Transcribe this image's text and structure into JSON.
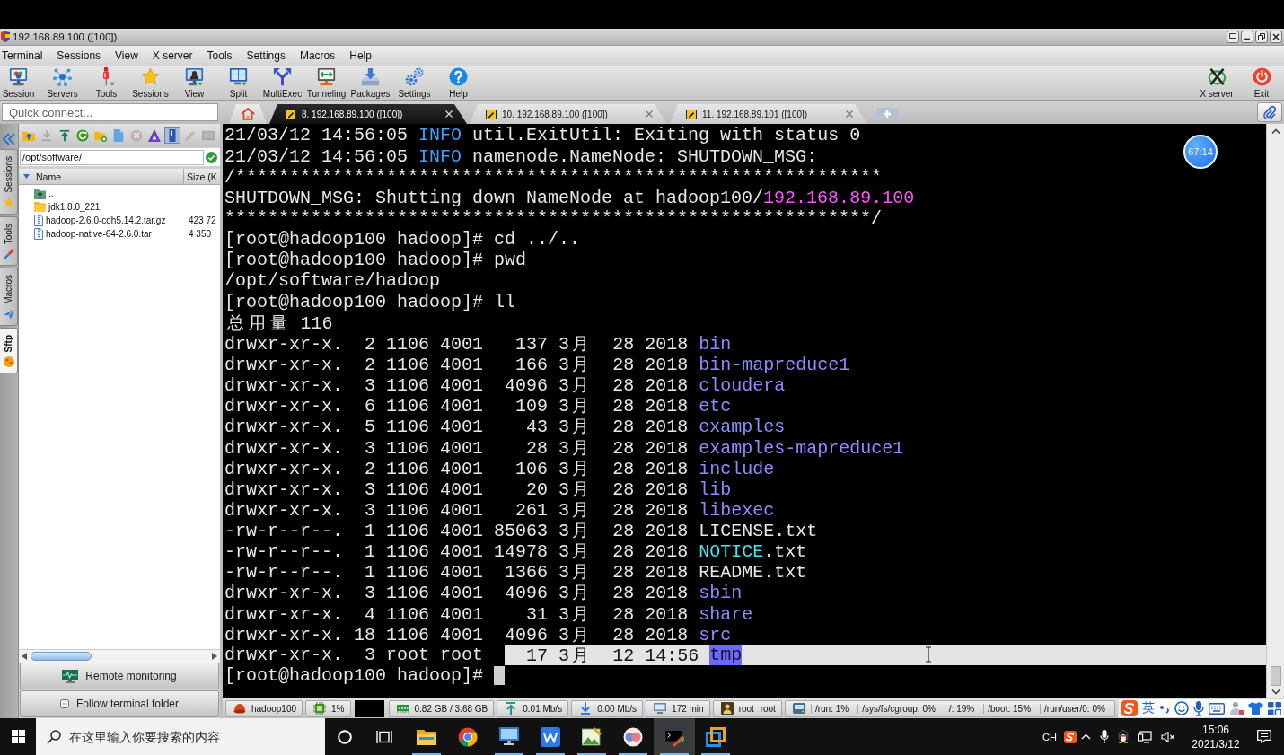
{
  "window": {
    "title": "192.168.89.100 ([100])"
  },
  "menu": [
    "Terminal",
    "Sessions",
    "View",
    "X server",
    "Tools",
    "Settings",
    "Macros",
    "Help"
  ],
  "toolbar": {
    "left": [
      "Session",
      "Servers",
      "Tools",
      "Sessions",
      "View",
      "Split",
      "MultiExec",
      "Tunneling",
      "Packages",
      "Settings",
      "Help"
    ],
    "right": [
      "X server",
      "Exit"
    ]
  },
  "quick_connect": {
    "placeholder": "Quick connect..."
  },
  "tabs": [
    {
      "label": "8. 192.168.89.100 ([100])",
      "selected": true
    },
    {
      "label": "10. 192.168.89.100 ([100])",
      "selected": false
    },
    {
      "label": "11. 192.168.89.101 ([100])",
      "selected": false
    }
  ],
  "side_tabs": [
    {
      "label": "Sessions",
      "selected": false
    },
    {
      "label": "Tools",
      "selected": false
    },
    {
      "label": "Macros",
      "selected": false
    },
    {
      "label": "Sftp",
      "selected": true
    }
  ],
  "sftp": {
    "toolbar": [
      {
        "disabled": false,
        "on": false
      },
      {
        "disabled": true,
        "on": false
      },
      {
        "disabled": false,
        "on": false
      },
      {
        "disabled": false,
        "on": false
      },
      {
        "disabled": false,
        "on": false
      },
      {
        "disabled": false,
        "on": false
      },
      {
        "disabled": true,
        "on": false
      },
      {
        "disabled": false,
        "on": false
      },
      {
        "disabled": false,
        "on": true
      },
      {
        "disabled": true,
        "on": false
      },
      {
        "disabled": true,
        "on": false
      }
    ],
    "path": "/opt/software/",
    "columns": [
      "Name",
      "Size (K"
    ],
    "rows": [
      {
        "kind": "parent",
        "name": ".."
      },
      {
        "kind": "folder",
        "name": "jdk1.8.0_221"
      },
      {
        "kind": "file",
        "name": "hadoop-2.6.0-cdh5.14.2.tar.gz",
        "size": "423 72"
      },
      {
        "kind": "file",
        "name": "hadoop-native-64-2.6.0.tar",
        "size": "4 350"
      }
    ],
    "remote_monitoring": "Remote monitoring",
    "follow_folder": {
      "label": "Follow terminal folder",
      "checked": false
    }
  },
  "terminal": {
    "lines": [
      {
        "segments": [
          {
            "text": "21/03/12 14:56:05 "
          },
          {
            "text": "INFO",
            "color": "#3aa2ff"
          },
          {
            "text": " util.ExitUtil: Exiting with status 0"
          }
        ]
      },
      {
        "segments": [
          {
            "text": "21/03/12 14:56:05 "
          },
          {
            "text": "INFO",
            "color": "#3aa2ff"
          },
          {
            "text": " namenode.NameNode: SHUTDOWN_MSG:"
          }
        ]
      },
      {
        "segments": [
          {
            "text": "/************************************************************"
          }
        ]
      },
      {
        "segments": [
          {
            "text": "SHUTDOWN_MSG: Shutting down NameNode at hadoop100/"
          },
          {
            "text": "192.168.89.100",
            "color": "#ff55ff"
          }
        ]
      },
      {
        "segments": [
          {
            "text": "************************************************************/"
          }
        ]
      },
      {
        "segments": [
          {
            "text": "[root@hadoop100 hadoop]# cd ../.."
          }
        ]
      },
      {
        "segments": [
          {
            "text": "[root@hadoop100 hadoop]# pwd"
          }
        ]
      },
      {
        "segments": [
          {
            "text": "/opt/software/hadoop"
          }
        ]
      },
      {
        "segments": [
          {
            "text": "[root@hadoop100 hadoop]# ll"
          }
        ]
      },
      {
        "segments": [
          {
            "text": "总用量 116"
          }
        ]
      },
      {
        "segments": [
          {
            "text": "drwxr-xr-x.  2 1106 4001   137 3月  28 2018 "
          },
          {
            "text": "bin",
            "color": "#8c8cff"
          }
        ]
      },
      {
        "segments": [
          {
            "text": "drwxr-xr-x.  2 1106 4001   166 3月  28 2018 "
          },
          {
            "text": "bin-mapreduce1",
            "color": "#8c8cff"
          }
        ]
      },
      {
        "segments": [
          {
            "text": "drwxr-xr-x.  3 1106 4001  4096 3月  28 2018 "
          },
          {
            "text": "cloudera",
            "color": "#8c8cff"
          }
        ]
      },
      {
        "segments": [
          {
            "text": "drwxr-xr-x.  6 1106 4001   109 3月  28 2018 "
          },
          {
            "text": "etc",
            "color": "#8c8cff"
          }
        ]
      },
      {
        "segments": [
          {
            "text": "drwxr-xr-x.  5 1106 4001    43 3月  28 2018 "
          },
          {
            "text": "examples",
            "color": "#8c8cff"
          }
        ]
      },
      {
        "segments": [
          {
            "text": "drwxr-xr-x.  3 1106 4001    28 3月  28 2018 "
          },
          {
            "text": "examples-mapreduce1",
            "color": "#8c8cff"
          }
        ]
      },
      {
        "segments": [
          {
            "text": "drwxr-xr-x.  2 1106 4001   106 3月  28 2018 "
          },
          {
            "text": "include",
            "color": "#8c8cff"
          }
        ]
      },
      {
        "segments": [
          {
            "text": "drwxr-xr-x.  3 1106 4001    20 3月  28 2018 "
          },
          {
            "text": "lib",
            "color": "#8c8cff"
          }
        ]
      },
      {
        "segments": [
          {
            "text": "drwxr-xr-x.  3 1106 4001   261 3月  28 2018 "
          },
          {
            "text": "libexec",
            "color": "#8c8cff"
          }
        ]
      },
      {
        "segments": [
          {
            "text": "-rw-r--r--.  1 1106 4001 85063 3月  28 2018 LICENSE.txt"
          }
        ]
      },
      {
        "segments": [
          {
            "text": "-rw-r--r--.  1 1106 4001 14978 3月  28 2018 "
          },
          {
            "text": "NOTICE",
            "color": "#3ee6f2"
          },
          {
            "text": ".txt"
          }
        ]
      },
      {
        "segments": [
          {
            "text": "-rw-r--r--.  1 1106 4001  1366 3月  28 2018 README.txt"
          }
        ]
      },
      {
        "segments": [
          {
            "text": "drwxr-xr-x.  3 1106 4001  4096 3月  28 2018 "
          },
          {
            "text": "sbin",
            "color": "#8c8cff"
          }
        ]
      },
      {
        "segments": [
          {
            "text": "drwxr-xr-x.  4 1106 4001    31 3月  28 2018 "
          },
          {
            "text": "share",
            "color": "#8c8cff"
          }
        ]
      },
      {
        "segments": [
          {
            "text": "drwxr-xr-x. 18 1106 4001  4096 3月  28 2018 "
          },
          {
            "text": "src",
            "color": "#8c8cff"
          }
        ]
      },
      {
        "segments": [
          {
            "text": "drwxr-xr-x.  3 root root  ",
            "selected": false
          },
          {
            "text": "  17 3月  12 14:56 ",
            "selected": true
          },
          {
            "text": "tmp",
            "color": "#6a6aff",
            "selected": true
          }
        ]
      }
    ],
    "prompt": {
      "text": "[root@hadoop100 hadoop]#",
      "cursor": true
    },
    "timer_badge": "67:14"
  },
  "status_bar": {
    "items": [
      "hadoop100",
      "1%",
      "0.82 GB / 3.68 GB",
      "0.01 Mb/s",
      "0.00 Mb/s",
      "172 min",
      "root root"
    ],
    "disks": [
      "/run: 1%",
      "/sys/fs/cgroup: 0%",
      "/: 19%",
      "/boot: 15%",
      "/run/user/0: 0%"
    ],
    "ime_mode": "英"
  },
  "taskbar": {
    "search_placeholder": "在这里输入你要搜索的内容",
    "apps": [
      {
        "running": true,
        "selected": false
      },
      {
        "running": false,
        "selected": false
      },
      {
        "running": true,
        "selected": false
      },
      {
        "running": true,
        "selected": false
      },
      {
        "running": true,
        "selected": false
      },
      {
        "running": true,
        "selected": false
      },
      {
        "running": true,
        "selected": true
      },
      {
        "running": true,
        "selected": false
      }
    ],
    "language": "CH",
    "time": "15:06",
    "date": "2021/3/12"
  }
}
